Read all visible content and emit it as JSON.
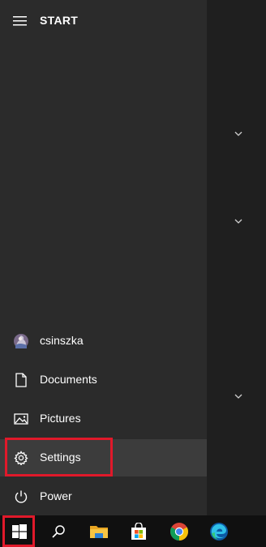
{
  "header": {
    "title": "START",
    "menu_icon": "hamburger-menu-icon"
  },
  "user": {
    "name": "csinszka",
    "icon": "user-avatar-icon"
  },
  "menu_items": [
    {
      "label": "Documents",
      "icon": "document-icon"
    },
    {
      "label": "Pictures",
      "icon": "pictures-icon"
    },
    {
      "label": "Settings",
      "icon": "gear-icon",
      "selected": true
    },
    {
      "label": "Power",
      "icon": "power-icon"
    }
  ],
  "tiles": {
    "expanders": [
      "chevron-down-icon",
      "chevron-down-icon",
      "chevron-down-icon"
    ]
  },
  "taskbar": {
    "items": [
      {
        "name": "start",
        "icon": "windows-logo-icon"
      },
      {
        "name": "search",
        "icon": "search-icon"
      },
      {
        "name": "file-explorer",
        "icon": "folder-icon"
      },
      {
        "name": "microsoft-store",
        "icon": "store-bag-icon"
      },
      {
        "name": "chrome",
        "icon": "chrome-icon"
      },
      {
        "name": "edge",
        "icon": "edge-icon"
      }
    ]
  },
  "colors": {
    "pane": "#2b2b2b",
    "tile_strip": "#1f1f1f",
    "taskbar": "#101010",
    "highlight": "#e0192a",
    "selected_row": "#3c3c3c"
  }
}
